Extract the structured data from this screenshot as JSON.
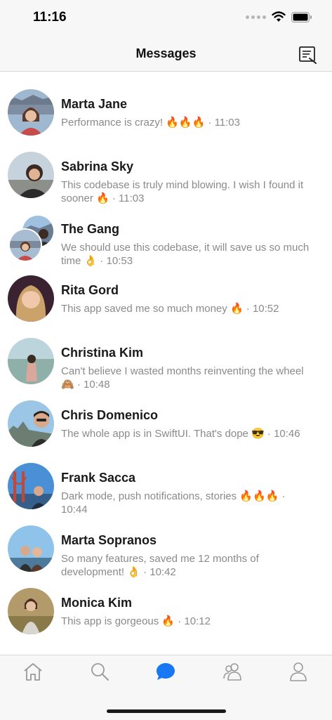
{
  "status_bar": {
    "time": "11:16"
  },
  "nav": {
    "title": "Messages",
    "compose_icon": "compose-icon"
  },
  "conversations": [
    {
      "name": "Marta Jane",
      "preview": "Performance is crazy! 🔥🔥🔥 · 11:03"
    },
    {
      "name": "Sabrina Sky",
      "preview": "This codebase is truly mind blowing.  I wish I found it sooner 🔥 · 11:03"
    },
    {
      "name": "The Gang",
      "preview": "We should use this codebase, it will save us so much time 👌 · 10:53"
    },
    {
      "name": "Rita Gord",
      "preview": "This app saved me so much money 🔥 · 10:52"
    },
    {
      "name": "Christina Kim",
      "preview": "Can't believe I wasted months reinventing the wheel 🙈 · 10:48"
    },
    {
      "name": "Chris Domenico",
      "preview": "The whole app is in SwiftUI. That's dope 😎 · 10:46"
    },
    {
      "name": "Frank Sacca",
      "preview": "Dark mode, push notifications, stories 🔥🔥🔥 · 10:44"
    },
    {
      "name": "Marta Sopranos",
      "preview": "So many features, saved me 12 months of development! 👌 · 10:42"
    },
    {
      "name": "Monica Kim",
      "preview": "This app is gorgeous 🔥 · 10:12"
    }
  ],
  "tabs": [
    {
      "icon": "home-icon"
    },
    {
      "icon": "search-icon"
    },
    {
      "icon": "chat-icon",
      "active": true
    },
    {
      "icon": "friends-icon"
    },
    {
      "icon": "profile-icon"
    }
  ],
  "colors": {
    "accent": "#1877f2",
    "inactive_tab": "#9a9a9a",
    "secondary_text": "#8a8a8a"
  }
}
